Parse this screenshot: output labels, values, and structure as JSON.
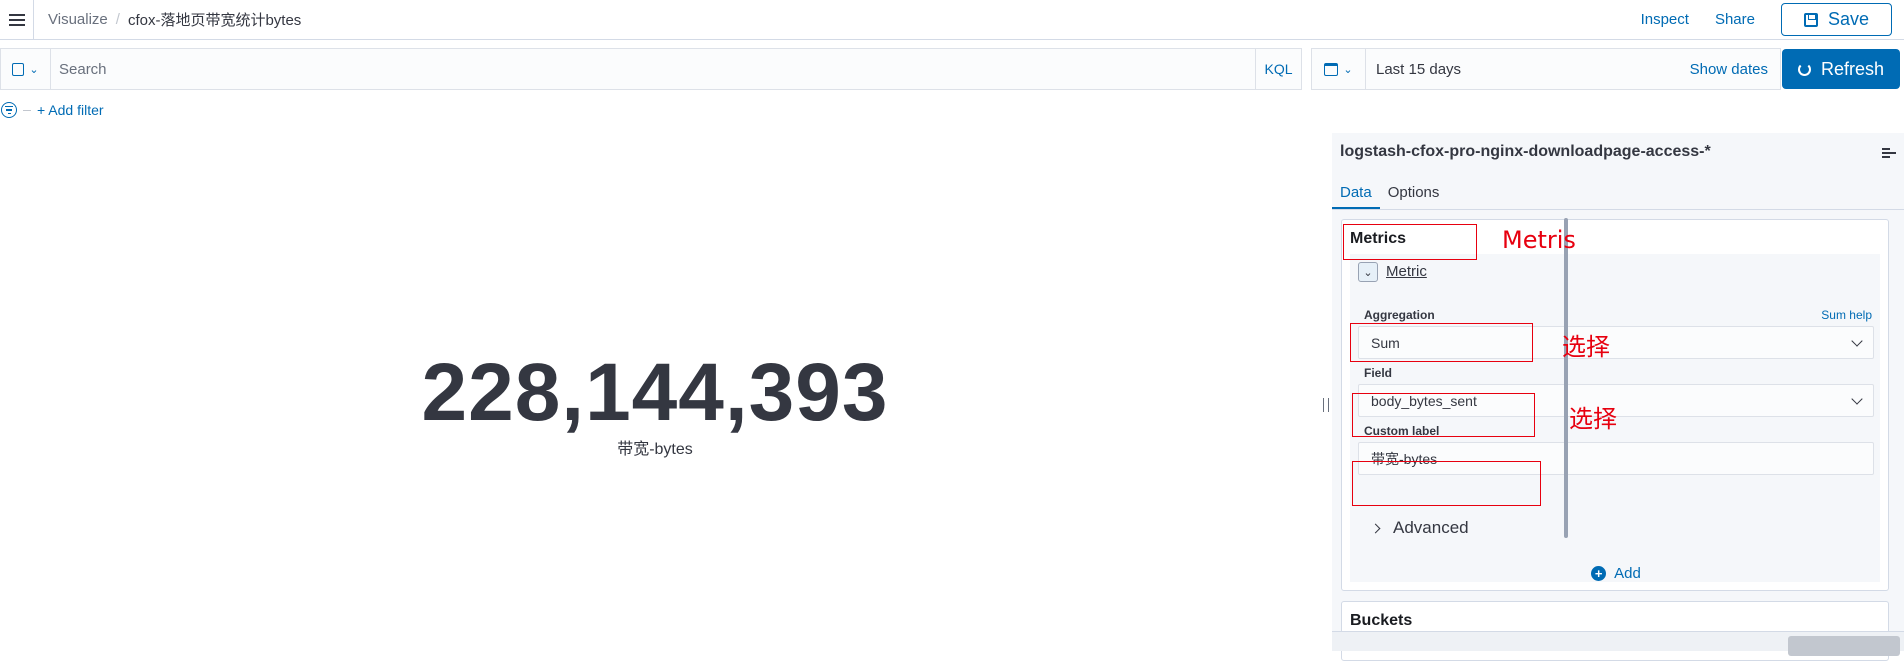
{
  "header": {
    "breadcrumb_root": "Visualize",
    "breadcrumb_separator": "/",
    "breadcrumb_current": "cfox-落地页带宽统计bytes",
    "inspect": "Inspect",
    "share": "Share",
    "save": "Save"
  },
  "query": {
    "placeholder": "Search",
    "language": "KQL",
    "time_range": "Last 15 days",
    "show_dates": "Show dates",
    "refresh": "Refresh"
  },
  "filters": {
    "add_filter": "+ Add filter"
  },
  "visualization": {
    "value": "228,144,393",
    "label": "带宽-bytes"
  },
  "sidebar": {
    "index_pattern": "logstash-cfox-pro-nginx-downloadpage-access-*",
    "tabs": [
      {
        "label": "Data",
        "active": true
      },
      {
        "label": "Options",
        "active": false
      }
    ],
    "metrics": {
      "title": "Metrics",
      "item_name": "Metric",
      "aggregation_label": "Aggregation",
      "aggregation_help": "Sum help",
      "aggregation_value": "Sum",
      "field_label": "Field",
      "field_value": "body_bytes_sent",
      "custom_label_label": "Custom label",
      "custom_label_value": "带宽-bytes",
      "advanced": "Advanced",
      "add": "Add"
    },
    "buckets": {
      "title": "Buckets"
    }
  },
  "annotations": {
    "metrics_note": "Metris",
    "aggregation_note": "选择",
    "field_note": "选择"
  },
  "colors": {
    "accent": "#006bb4",
    "annotation": "#e7000f",
    "text": "#343741"
  }
}
